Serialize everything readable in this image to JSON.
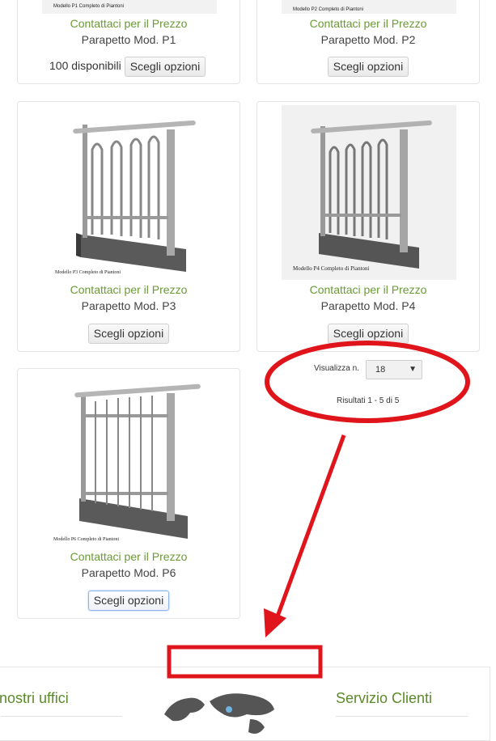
{
  "products": [
    {
      "caption": "Modello P1 Completo di Piantoni",
      "price_link": "Contattaci per il Prezzo",
      "title": "Parapetto Mod. P1",
      "stock": "100 disponibili",
      "button": "Scegli opzioni"
    },
    {
      "caption": "Modello P2 Completo di Piantoni",
      "price_link": "Contattaci per il Prezzo",
      "title": "Parapetto Mod. P2",
      "button": "Scegli opzioni"
    },
    {
      "caption": "Modello P3 Completo di Piantoni",
      "price_link": "Contattaci per il Prezzo",
      "title": "Parapetto Mod. P3",
      "button": "Scegli opzioni"
    },
    {
      "caption": "Modello P4 Completo di Piantoni",
      "price_link": "Contattaci per il Prezzo",
      "title": "Parapetto Mod. P4",
      "button": "Scegli opzioni"
    },
    {
      "caption": "Modello P6 Completo di Piantoni",
      "price_link": "Contattaci per il Prezzo",
      "title": "Parapetto Mod. P6",
      "button": "Scegli opzioni"
    }
  ],
  "pager": {
    "per_page_label": "Visualizza n.",
    "per_page_value": "18",
    "results": "Risultati 1 - 5 di 5"
  },
  "footer": {
    "left_heading": "nostri uffici",
    "right_heading": "Servizio Clienti"
  },
  "annotation_color": "#e0141b",
  "accent_color": "#6a9b35"
}
